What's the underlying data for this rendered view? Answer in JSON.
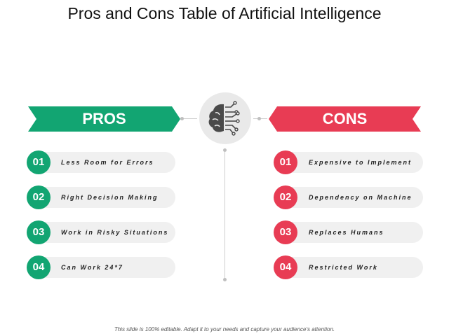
{
  "title": "Pros and Cons Table of Artificial Intelligence",
  "colors": {
    "pros": "#12a572",
    "cons": "#e83c54",
    "item_bg": "#f0f0f0",
    "circle_bg": "#e9e9e9"
  },
  "pros": {
    "heading": "PROS",
    "items": [
      {
        "num": "01",
        "text": "Less Room for Errors"
      },
      {
        "num": "02",
        "text": "Right Decision Making"
      },
      {
        "num": "03",
        "text": "Work in Risky Situations"
      },
      {
        "num": "04",
        "text": "Can Work 24*7"
      }
    ]
  },
  "cons": {
    "heading": "CONS",
    "items": [
      {
        "num": "01",
        "text": "Expensive to Implement"
      },
      {
        "num": "02",
        "text": "Dependency on Machine"
      },
      {
        "num": "03",
        "text": "Replaces Humans"
      },
      {
        "num": "04",
        "text": "Restricted Work"
      }
    ]
  },
  "center_icon": "brain-circuit-icon",
  "footer": "This slide is 100% editable. Adapt it to your needs and capture your audience's attention."
}
